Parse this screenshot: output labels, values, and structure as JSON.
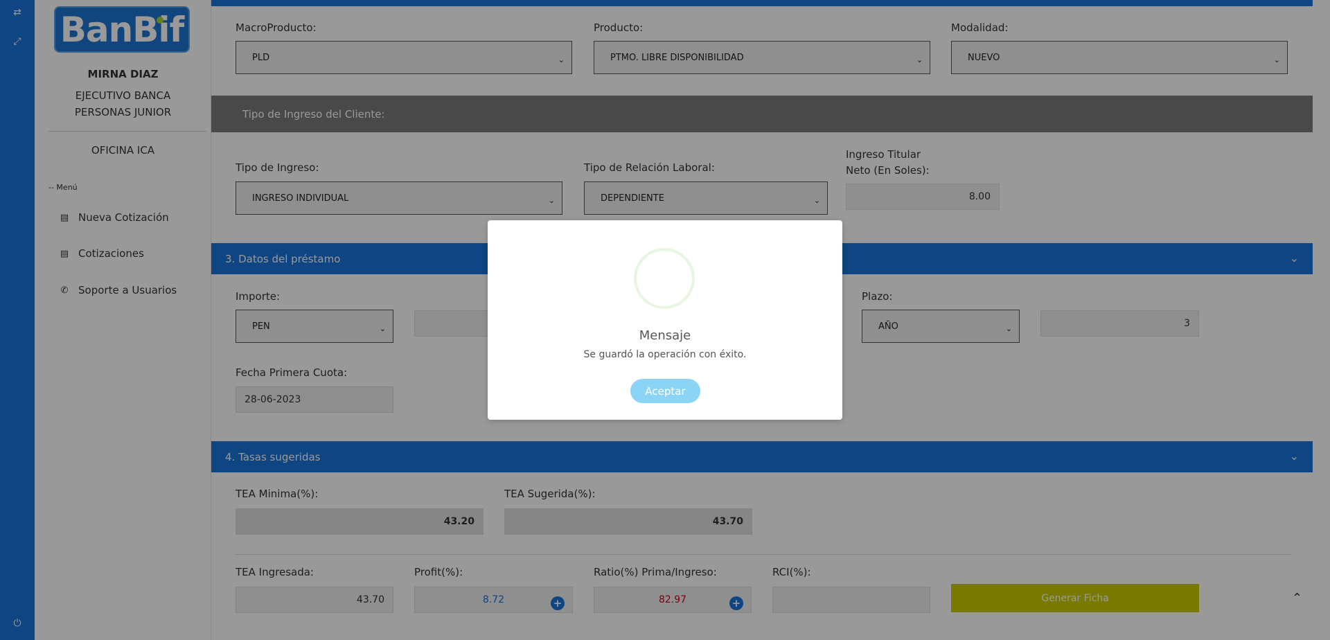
{
  "rail": {
    "icons": [
      "swap-icon",
      "fullscreen-icon",
      "power-icon"
    ]
  },
  "sidebar": {
    "logo": "BanBif",
    "user_name": "MIRNA DIAZ",
    "user_role_line1": "EJECUTIVO BANCA",
    "user_role_line2": "PERSONAS JUNIOR",
    "office": "OFICINA ICA",
    "menu_header": "-- Menú",
    "items": [
      {
        "label": "Nueva Cotización",
        "icon": "id-card-icon"
      },
      {
        "label": "Cotizaciones",
        "icon": "id-card-icon"
      },
      {
        "label": "Soporte a Usuarios",
        "icon": "phone-icon"
      }
    ]
  },
  "product": {
    "macro_label": "MacroProducto:",
    "macro_value": "PLD",
    "product_label": "Producto:",
    "product_value": "PTMO. LIBRE DISPONIBILIDAD",
    "mode_label": "Modalidad:",
    "mode_value": "NUEVO"
  },
  "income": {
    "header": "Tipo de Ingreso del Cliente:",
    "type_label": "Tipo de Ingreso:",
    "type_value": "INGRESO INDIVIDUAL",
    "relation_label": "Tipo de Relación Laboral:",
    "relation_value": "DEPENDIENTE",
    "net_label_line1": "Ingreso Titular",
    "net_label_line2": "Neto (En Soles):",
    "net_value": "8.00"
  },
  "loan": {
    "header": "3. Datos del préstamo",
    "amount_label": "Importe:",
    "currency_value": "PEN",
    "amount_value": "",
    "term_label": "Plazo:",
    "term_unit": "AÑO",
    "term_value": "3",
    "first_due_label": "Fecha Primera Cuota:",
    "first_due_value": "28-06-2023"
  },
  "rates": {
    "header": "4. Tasas sugeridas",
    "tea_min_label": "TEA Minima(%):",
    "tea_min_value": "43.20",
    "tea_sug_label": "TEA Sugerida(%):",
    "tea_sug_value": "43.70",
    "tea_in_label": "TEA Ingresada:",
    "tea_in_value": "43.70",
    "profit_label": "Profit(%):",
    "profit_value": "8.72",
    "ratio_label": "Ratio(%) Prima/Ingreso:",
    "ratio_value": "82.97",
    "rci_label": "RCI(%):",
    "rci_value": "",
    "generate_button": "Generar Ficha"
  },
  "modal": {
    "title": "Mensaje",
    "text": "Se guardó la operación con éxito.",
    "button": "Aceptar"
  },
  "colors": {
    "brand_blue": "#1a73d9",
    "profit_color": "#1a73d9",
    "ratio_color": "#d0021b",
    "generate_button": "#c8cc00",
    "modal_button": "#8cd4f5"
  }
}
